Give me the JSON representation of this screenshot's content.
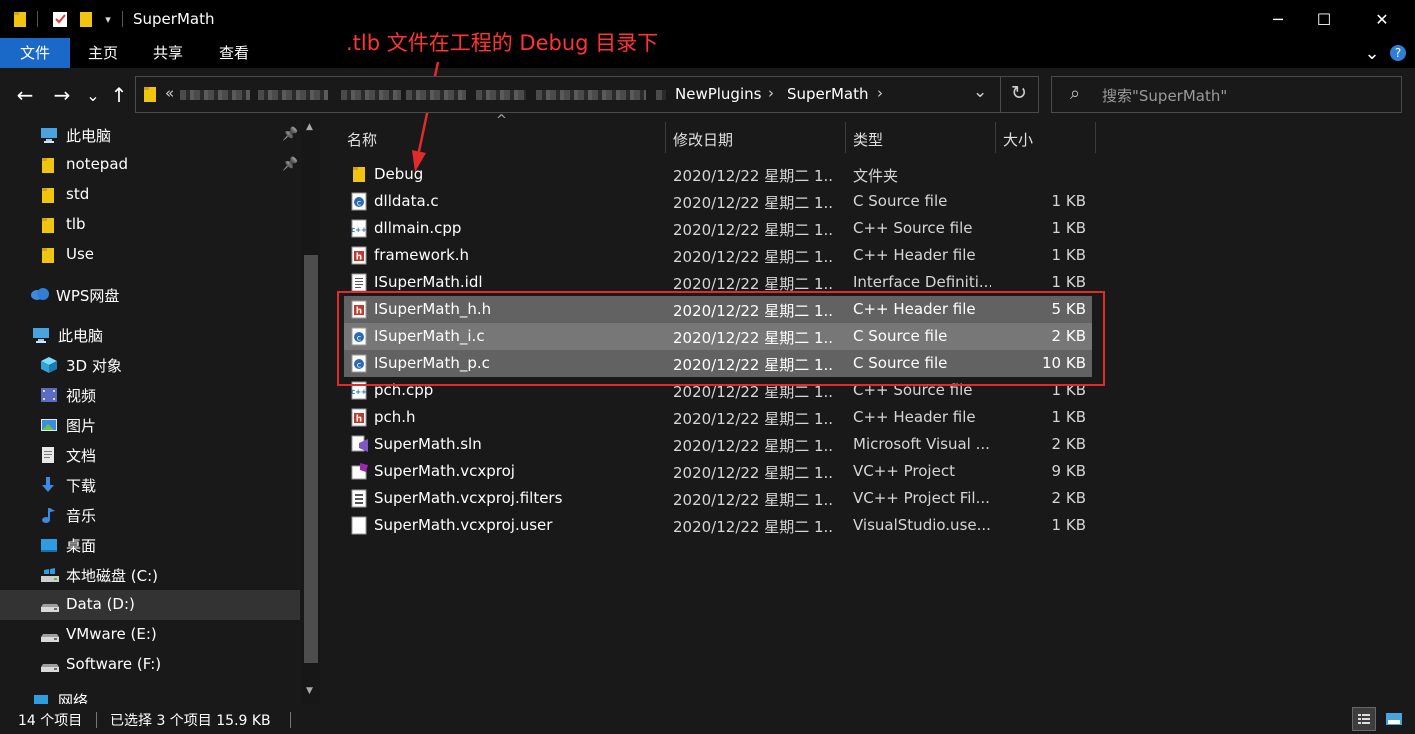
{
  "window": {
    "title": "SuperMath",
    "minimize_glyph": "─",
    "maximize_glyph": "☐",
    "close_glyph": "✕"
  },
  "ribbon": {
    "tabs": [
      "文件",
      "主页",
      "共享",
      "查看"
    ],
    "active_tab": "文件",
    "accent": "#1a68c7",
    "expand_glyph": "⌄",
    "help_glyph": "?"
  },
  "annotation": {
    "text": ".tlb 文件在工程的 Debug 目录下",
    "color": "#ff3333"
  },
  "navigation": {
    "back_glyph": "←",
    "forward_glyph": "→",
    "recent_glyph": "⌄",
    "up_glyph": "↑"
  },
  "address": {
    "overflow_glyph": "«",
    "crumbs": [
      "NewPlugins",
      "SuperMath"
    ],
    "separator_glyph": "›",
    "dropdown_glyph": "⌄",
    "refresh_glyph": "↻"
  },
  "search": {
    "placeholder": "搜索\"SuperMath\"",
    "icon_glyph": "⌕"
  },
  "sidebar": {
    "pin_glyph": "📌",
    "items": [
      {
        "label": "此电脑",
        "icon": "computer-icon",
        "pinned": true
      },
      {
        "label": "notepad",
        "icon": "folder-icon",
        "pinned": true
      },
      {
        "label": "std",
        "icon": "folder-icon",
        "pinned": false
      },
      {
        "label": "tlb",
        "icon": "folder-icon",
        "pinned": false
      },
      {
        "label": "Use",
        "icon": "folder-icon",
        "pinned": false
      },
      {
        "label": "WPS网盘",
        "icon": "cloud-icon",
        "pinned": false
      },
      {
        "label": "此电脑",
        "icon": "computer-icon",
        "pinned": false
      },
      {
        "label": "3D 对象",
        "icon": "cube-icon",
        "pinned": false
      },
      {
        "label": "视频",
        "icon": "video-icon",
        "pinned": false
      },
      {
        "label": "图片",
        "icon": "picture-icon",
        "pinned": false
      },
      {
        "label": "文档",
        "icon": "document-icon",
        "pinned": false
      },
      {
        "label": "下载",
        "icon": "download-icon",
        "pinned": false
      },
      {
        "label": "音乐",
        "icon": "music-icon",
        "pinned": false
      },
      {
        "label": "桌面",
        "icon": "desktop-icon",
        "pinned": false
      },
      {
        "label": "本地磁盘 (C:)",
        "icon": "system-drive-icon",
        "pinned": false
      },
      {
        "label": "Data (D:)",
        "icon": "drive-icon",
        "pinned": false
      },
      {
        "label": "VMware (E:)",
        "icon": "drive-icon",
        "pinned": false
      },
      {
        "label": "Software (F:)",
        "icon": "drive-icon",
        "pinned": false
      },
      {
        "label": "网络",
        "icon": "network-icon",
        "pinned": false
      }
    ],
    "selected_item": "Data (D:)"
  },
  "columns": {
    "name": "名称",
    "date": "修改日期",
    "type": "类型",
    "size": "大小",
    "sort_glyph": "^"
  },
  "files": [
    {
      "name": "Debug",
      "date": "2020/12/22 星期二 1...",
      "type": "文件夹",
      "size": "",
      "icon": "folder-icon",
      "selected": false
    },
    {
      "name": "dlldata.c",
      "date": "2020/12/22 星期二 1...",
      "type": "C Source file",
      "size": "1 KB",
      "icon": "c-file-icon",
      "selected": false
    },
    {
      "name": "dllmain.cpp",
      "date": "2020/12/22 星期二 1...",
      "type": "C++ Source file",
      "size": "1 KB",
      "icon": "cpp-file-icon",
      "selected": false
    },
    {
      "name": "framework.h",
      "date": "2020/12/22 星期二 1...",
      "type": "C++ Header file",
      "size": "1 KB",
      "icon": "h-file-icon",
      "selected": false
    },
    {
      "name": "ISuperMath.idl",
      "date": "2020/12/22 星期二 1...",
      "type": "Interface Definiti...",
      "size": "1 KB",
      "icon": "idl-file-icon",
      "selected": false
    },
    {
      "name": "ISuperMath_h.h",
      "date": "2020/12/22 星期二 1...",
      "type": "C++ Header file",
      "size": "5 KB",
      "icon": "h-file-icon",
      "selected": true
    },
    {
      "name": "ISuperMath_i.c",
      "date": "2020/12/22 星期二 1...",
      "type": "C Source file",
      "size": "2 KB",
      "icon": "c-file-icon",
      "selected": true
    },
    {
      "name": "ISuperMath_p.c",
      "date": "2020/12/22 星期二 1...",
      "type": "C Source file",
      "size": "10 KB",
      "icon": "c-file-icon",
      "selected": true
    },
    {
      "name": "pch.cpp",
      "date": "2020/12/22 星期二 1...",
      "type": "C++ Source file",
      "size": "1 KB",
      "icon": "cpp-file-icon",
      "selected": false
    },
    {
      "name": "pch.h",
      "date": "2020/12/22 星期二 1...",
      "type": "C++ Header file",
      "size": "1 KB",
      "icon": "h-file-icon",
      "selected": false
    },
    {
      "name": "SuperMath.sln",
      "date": "2020/12/22 星期二 1...",
      "type": "Microsoft Visual ...",
      "size": "2 KB",
      "icon": "sln-file-icon",
      "selected": false
    },
    {
      "name": "SuperMath.vcxproj",
      "date": "2020/12/22 星期二 1...",
      "type": "VC++ Project",
      "size": "9 KB",
      "icon": "vcxproj-file-icon",
      "selected": false
    },
    {
      "name": "SuperMath.vcxproj.filters",
      "date": "2020/12/22 星期二 1...",
      "type": "VC++ Project Fil...",
      "size": "2 KB",
      "icon": "filters-file-icon",
      "selected": false
    },
    {
      "name": "SuperMath.vcxproj.user",
      "date": "2020/12/22 星期二 1...",
      "type": "VisualStudio.use...",
      "size": "1 KB",
      "icon": "user-file-icon",
      "selected": false
    }
  ],
  "status": {
    "item_count": "14 个项目",
    "selection": "已选择 3 个项目  15.9 KB"
  },
  "colors": {
    "highlight_box": "#e12b2b",
    "selected_row": "#777777"
  }
}
